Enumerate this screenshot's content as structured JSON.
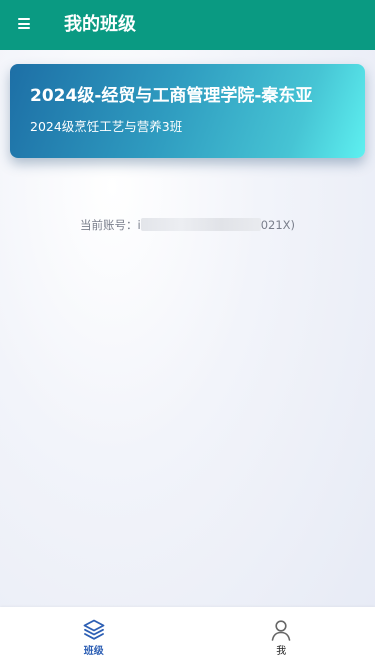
{
  "header": {
    "title": "我的班级",
    "menu_icon": "hamburger-menu-icon",
    "background_color": "#0a9a82"
  },
  "class_card": {
    "title": "2024级-经贸与工商管理学院-秦东亚",
    "subtitle": "2024级烹饪工艺与营养3班"
  },
  "account": {
    "prefix": "当前账号：",
    "redacted_start": "i",
    "suffix": "021X)"
  },
  "bottom_nav": {
    "items": [
      {
        "label": "班级",
        "icon": "layers-icon",
        "active": true
      },
      {
        "label": "我",
        "icon": "user-icon",
        "active": false
      }
    ],
    "active_color": "#2d5fb4"
  }
}
